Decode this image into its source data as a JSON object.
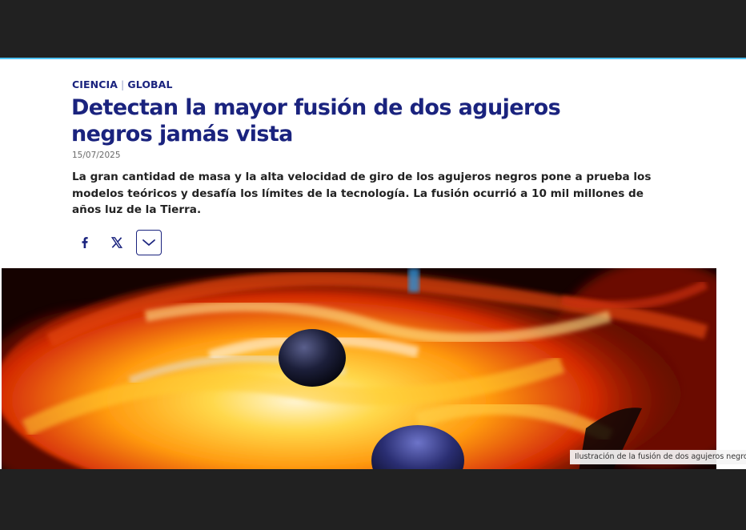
{
  "article": {
    "section_primary": "CIENCIA",
    "section_separator": "|",
    "section_secondary": "GLOBAL",
    "headline": "Detectan la mayor fusión de dos agujeros negros jamás vista",
    "date": "15/07/2025",
    "summary": "La gran cantidad de masa y la alta velocidad de giro de los agujeros negros pone a prueba los modelos teóricos y desafía los límites de la tecnología. La fusión ocurrió a 10 mil millones de años luz de la Tierra."
  },
  "share": {
    "buttons": [
      {
        "icon": "facebook-icon"
      },
      {
        "icon": "x-icon"
      },
      {
        "icon": "chevron-down-icon"
      }
    ]
  },
  "image": {
    "caption": "Ilustración de la fusión de dos agujeros negros."
  },
  "colors": {
    "brand_navy": "#1a237e",
    "accent_line": "#4fc3f7",
    "frame_dark": "#212121"
  }
}
